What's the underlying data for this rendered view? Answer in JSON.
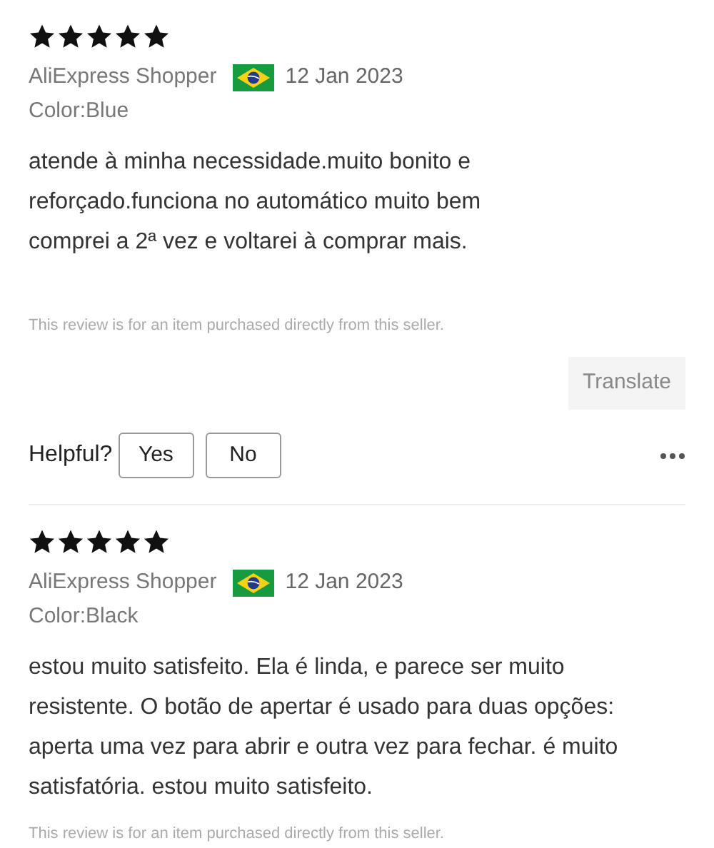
{
  "reviews": [
    {
      "stars": 5,
      "author": "AliExpress Shopper",
      "date": "12 Jan 2023",
      "variant": "Color:Blue",
      "text_lines": [
        "atende à minha necessidade.muito bonito e",
        "reforçado.funciona no automático muito bem",
        "comprei a 2ª vez e voltarei à comprar mais."
      ],
      "note": "This review is for an item purchased directly from this seller.",
      "translate": "Translate",
      "helpful": {
        "label": "Helpful?",
        "buttons": [
          "Yes",
          "No"
        ]
      }
    },
    {
      "stars": 5,
      "author": "AliExpress Shopper",
      "date": "12 Jan 2023",
      "variant": "Color:Black",
      "text_lines": [
        "estou muito satisfeito. Ela é linda, e parece ser muito",
        "resistente. O botão de apertar é usado para duas opções:",
        "aperta uma vez para abrir e outra vez para fechar. é muito",
        "satisfatória. estou muito satisfeito."
      ],
      "note": "This review is for an item purchased directly from this seller."
    }
  ]
}
